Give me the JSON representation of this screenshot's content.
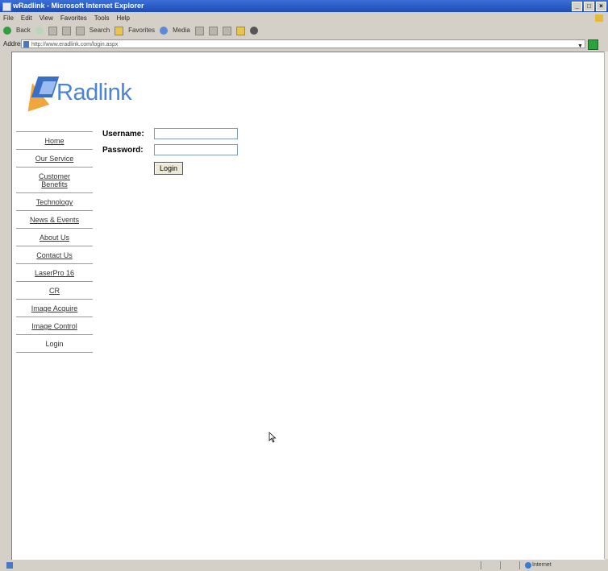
{
  "window": {
    "title": "wRadlink - Microsoft Internet Explorer",
    "controls": [
      "_",
      "□",
      "×"
    ]
  },
  "menubar": {
    "items": [
      "File",
      "Edit",
      "View",
      "Favorites",
      "Tools",
      "Help"
    ]
  },
  "toolbar": {
    "back_label": "Back",
    "search_label": "Search",
    "favorites_label": "Favorites",
    "media_label": "Media"
  },
  "addressbar": {
    "label": "Address",
    "url": "http://www.eradlink.com/login.aspx",
    "go_label": "Go"
  },
  "brand": {
    "name": "Radlink",
    "color": "#4a84d4",
    "accent": "#f0a63a"
  },
  "nav": {
    "items": [
      "Home",
      "Our Service",
      "Customer Benefits",
      "Technology",
      "News & Events",
      "About Us",
      "Contact Us",
      "LaserPro 16",
      "CR",
      "Image Acquire",
      "Image Control",
      "Login"
    ]
  },
  "login": {
    "username_label": "Username:",
    "password_label": "Password:",
    "username_value": "",
    "password_value": "",
    "button_label": "Login"
  },
  "statusbar": {
    "zone": "Internet"
  }
}
